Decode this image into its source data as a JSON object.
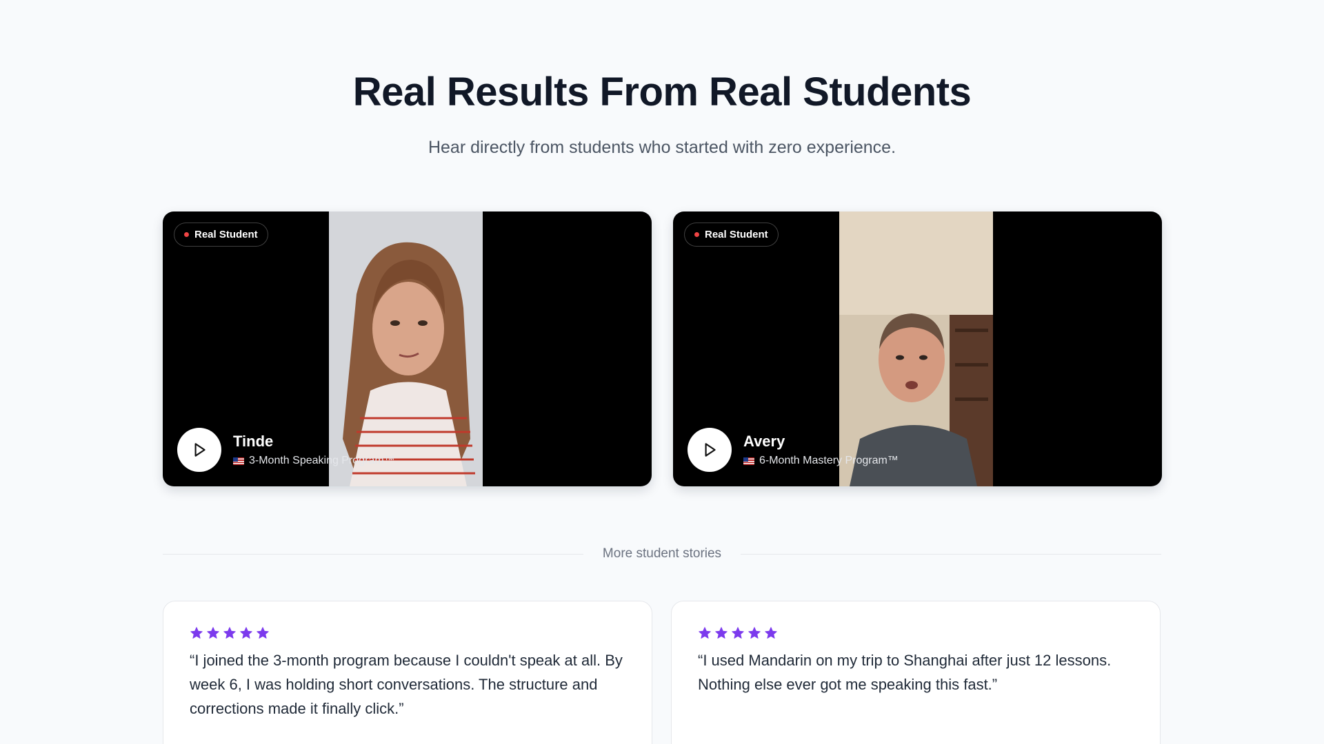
{
  "header": {
    "title": "Real Results From Real Students",
    "subtitle": "Hear directly from students who started with zero experience."
  },
  "videos": [
    {
      "badge": "Real Student",
      "name": "Tinde",
      "program": "3-Month Speaking Program™"
    },
    {
      "badge": "Real Student",
      "name": "Avery",
      "program": "6-Month Mastery Program™"
    }
  ],
  "divider": {
    "label": "More student stories"
  },
  "reviews": [
    {
      "rating": 5,
      "quote": "“I joined the 3-month program because I couldn't speak at all. By week 6, I was holding short conversations. The structure and corrections made it finally click.”"
    },
    {
      "rating": 5,
      "quote": "“I used Mandarin on my trip to Shanghai after just 12 lessons. Nothing else ever got me speaking this fast.”"
    }
  ],
  "colors": {
    "accent": "#7c3aed",
    "badge_dot": "#ef4444",
    "background": "#f8fafc"
  },
  "icons": {
    "play": "play-icon",
    "star": "star-icon",
    "flag": "us-flag-icon"
  }
}
